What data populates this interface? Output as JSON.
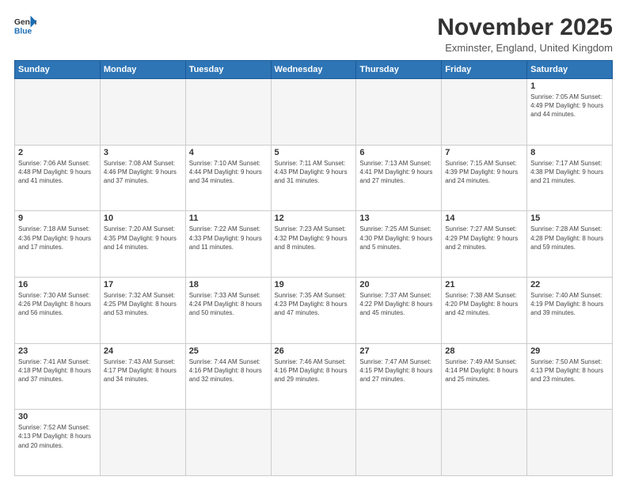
{
  "header": {
    "logo_general": "General",
    "logo_blue": "Blue",
    "title": "November 2025",
    "subtitle": "Exminster, England, United Kingdom"
  },
  "weekdays": [
    "Sunday",
    "Monday",
    "Tuesday",
    "Wednesday",
    "Thursday",
    "Friday",
    "Saturday"
  ],
  "weeks": [
    [
      {
        "day": "",
        "info": ""
      },
      {
        "day": "",
        "info": ""
      },
      {
        "day": "",
        "info": ""
      },
      {
        "day": "",
        "info": ""
      },
      {
        "day": "",
        "info": ""
      },
      {
        "day": "",
        "info": ""
      },
      {
        "day": "1",
        "info": "Sunrise: 7:05 AM\nSunset: 4:49 PM\nDaylight: 9 hours\nand 44 minutes."
      }
    ],
    [
      {
        "day": "2",
        "info": "Sunrise: 7:06 AM\nSunset: 4:48 PM\nDaylight: 9 hours\nand 41 minutes."
      },
      {
        "day": "3",
        "info": "Sunrise: 7:08 AM\nSunset: 4:46 PM\nDaylight: 9 hours\nand 37 minutes."
      },
      {
        "day": "4",
        "info": "Sunrise: 7:10 AM\nSunset: 4:44 PM\nDaylight: 9 hours\nand 34 minutes."
      },
      {
        "day": "5",
        "info": "Sunrise: 7:11 AM\nSunset: 4:43 PM\nDaylight: 9 hours\nand 31 minutes."
      },
      {
        "day": "6",
        "info": "Sunrise: 7:13 AM\nSunset: 4:41 PM\nDaylight: 9 hours\nand 27 minutes."
      },
      {
        "day": "7",
        "info": "Sunrise: 7:15 AM\nSunset: 4:39 PM\nDaylight: 9 hours\nand 24 minutes."
      },
      {
        "day": "8",
        "info": "Sunrise: 7:17 AM\nSunset: 4:38 PM\nDaylight: 9 hours\nand 21 minutes."
      }
    ],
    [
      {
        "day": "9",
        "info": "Sunrise: 7:18 AM\nSunset: 4:36 PM\nDaylight: 9 hours\nand 17 minutes."
      },
      {
        "day": "10",
        "info": "Sunrise: 7:20 AM\nSunset: 4:35 PM\nDaylight: 9 hours\nand 14 minutes."
      },
      {
        "day": "11",
        "info": "Sunrise: 7:22 AM\nSunset: 4:33 PM\nDaylight: 9 hours\nand 11 minutes."
      },
      {
        "day": "12",
        "info": "Sunrise: 7:23 AM\nSunset: 4:32 PM\nDaylight: 9 hours\nand 8 minutes."
      },
      {
        "day": "13",
        "info": "Sunrise: 7:25 AM\nSunset: 4:30 PM\nDaylight: 9 hours\nand 5 minutes."
      },
      {
        "day": "14",
        "info": "Sunrise: 7:27 AM\nSunset: 4:29 PM\nDaylight: 9 hours\nand 2 minutes."
      },
      {
        "day": "15",
        "info": "Sunrise: 7:28 AM\nSunset: 4:28 PM\nDaylight: 8 hours\nand 59 minutes."
      }
    ],
    [
      {
        "day": "16",
        "info": "Sunrise: 7:30 AM\nSunset: 4:26 PM\nDaylight: 8 hours\nand 56 minutes."
      },
      {
        "day": "17",
        "info": "Sunrise: 7:32 AM\nSunset: 4:25 PM\nDaylight: 8 hours\nand 53 minutes."
      },
      {
        "day": "18",
        "info": "Sunrise: 7:33 AM\nSunset: 4:24 PM\nDaylight: 8 hours\nand 50 minutes."
      },
      {
        "day": "19",
        "info": "Sunrise: 7:35 AM\nSunset: 4:23 PM\nDaylight: 8 hours\nand 47 minutes."
      },
      {
        "day": "20",
        "info": "Sunrise: 7:37 AM\nSunset: 4:22 PM\nDaylight: 8 hours\nand 45 minutes."
      },
      {
        "day": "21",
        "info": "Sunrise: 7:38 AM\nSunset: 4:20 PM\nDaylight: 8 hours\nand 42 minutes."
      },
      {
        "day": "22",
        "info": "Sunrise: 7:40 AM\nSunset: 4:19 PM\nDaylight: 8 hours\nand 39 minutes."
      }
    ],
    [
      {
        "day": "23",
        "info": "Sunrise: 7:41 AM\nSunset: 4:18 PM\nDaylight: 8 hours\nand 37 minutes."
      },
      {
        "day": "24",
        "info": "Sunrise: 7:43 AM\nSunset: 4:17 PM\nDaylight: 8 hours\nand 34 minutes."
      },
      {
        "day": "25",
        "info": "Sunrise: 7:44 AM\nSunset: 4:16 PM\nDaylight: 8 hours\nand 32 minutes."
      },
      {
        "day": "26",
        "info": "Sunrise: 7:46 AM\nSunset: 4:16 PM\nDaylight: 8 hours\nand 29 minutes."
      },
      {
        "day": "27",
        "info": "Sunrise: 7:47 AM\nSunset: 4:15 PM\nDaylight: 8 hours\nand 27 minutes."
      },
      {
        "day": "28",
        "info": "Sunrise: 7:49 AM\nSunset: 4:14 PM\nDaylight: 8 hours\nand 25 minutes."
      },
      {
        "day": "29",
        "info": "Sunrise: 7:50 AM\nSunset: 4:13 PM\nDaylight: 8 hours\nand 23 minutes."
      }
    ],
    [
      {
        "day": "30",
        "info": "Sunrise: 7:52 AM\nSunset: 4:13 PM\nDaylight: 8 hours\nand 20 minutes."
      },
      {
        "day": "",
        "info": ""
      },
      {
        "day": "",
        "info": ""
      },
      {
        "day": "",
        "info": ""
      },
      {
        "day": "",
        "info": ""
      },
      {
        "day": "",
        "info": ""
      },
      {
        "day": "",
        "info": ""
      }
    ]
  ]
}
